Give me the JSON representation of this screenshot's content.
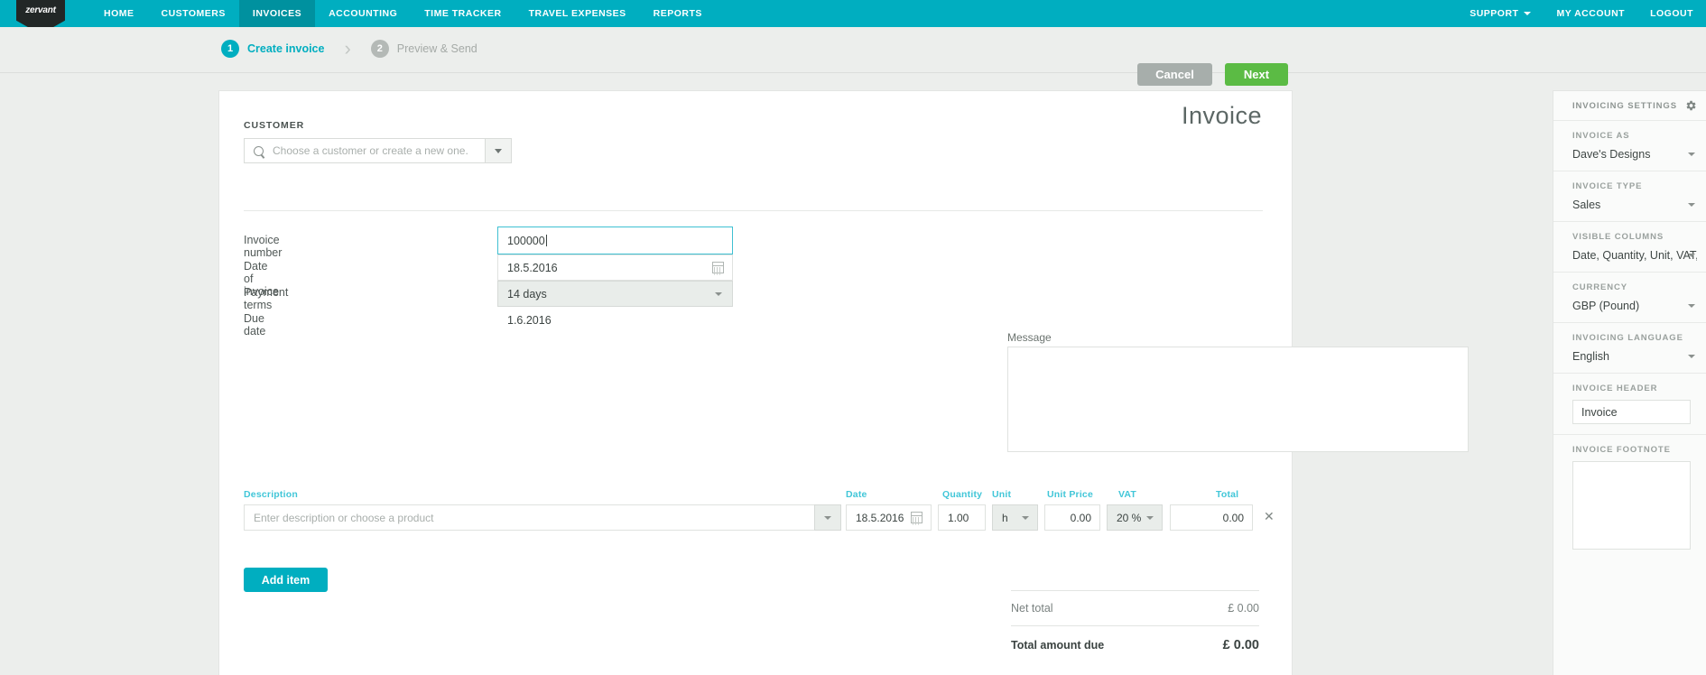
{
  "brand": {
    "logo_text": "zervant",
    "accent": "#00aec0",
    "nav_active_bg": "#00919f",
    "green": "#5bbb44",
    "gray_btn": "#a7aeab"
  },
  "topnav": {
    "items": [
      {
        "label": "HOME",
        "active": false
      },
      {
        "label": "CUSTOMERS",
        "active": false
      },
      {
        "label": "INVOICES",
        "active": true
      },
      {
        "label": "ACCOUNTING",
        "active": false
      },
      {
        "label": "TIME TRACKER",
        "active": false
      },
      {
        "label": "TRAVEL EXPENSES",
        "active": false
      },
      {
        "label": "REPORTS",
        "active": false
      }
    ],
    "right_items": [
      {
        "label": "SUPPORT",
        "caret": true
      },
      {
        "label": "MY ACCOUNT",
        "caret": false
      },
      {
        "label": "LOGOUT",
        "caret": false
      }
    ]
  },
  "stepbar": {
    "step1_num": "1",
    "step1_label": "Create invoice",
    "separator": "›",
    "step2_num": "2",
    "step2_label": "Preview & Send",
    "cancel_label": "Cancel",
    "next_label": "Next"
  },
  "invoice": {
    "title": "Invoice",
    "customer_label": "CUSTOMER",
    "customer_placeholder": "Choose a customer or create a new one.",
    "customer_value": "",
    "fields": [
      {
        "label": "Invoice number",
        "value": "100000"
      },
      {
        "label": "Date of invoice",
        "value": "18.5.2016"
      },
      {
        "label": "Payment terms",
        "value": "14 days"
      },
      {
        "label": "Due date",
        "value": "1.6.2016"
      }
    ],
    "message_label": "Message",
    "message_value": ""
  },
  "line_items": {
    "headers": {
      "description": "Description",
      "date": "Date",
      "quantity": "Quantity",
      "unit": "Unit",
      "unit_price": "Unit Price",
      "vat": "VAT",
      "total": "Total"
    },
    "rows": [
      {
        "description_placeholder": "Enter description or choose a product",
        "description": "",
        "date": "18.5.2016",
        "quantity": "1.00",
        "unit": "h",
        "unit_price": "0.00",
        "vat": "20 %",
        "total": "0.00",
        "delete_glyph": "✕"
      }
    ],
    "add_item_label": "Add item"
  },
  "totals": {
    "net_label": "Net total",
    "net_value": "£ 0.00",
    "grand_label": "Total amount due",
    "grand_value": "£ 0.00"
  },
  "sidebar": {
    "title": "INVOICING SETTINGS",
    "sections": [
      {
        "label": "INVOICE AS",
        "value": "Dave's Designs",
        "type": "select"
      },
      {
        "label": "INVOICE TYPE",
        "value": "Sales",
        "type": "select"
      },
      {
        "label": "VISIBLE COLUMNS",
        "value": "Date, Quantity, Unit, VAT, U…",
        "type": "select"
      },
      {
        "label": "CURRENCY",
        "value": "GBP (Pound)",
        "type": "select"
      },
      {
        "label": "INVOICING LANGUAGE",
        "value": "English",
        "type": "select"
      },
      {
        "label": "INVOICE HEADER",
        "value": "Invoice",
        "type": "input"
      },
      {
        "label": "INVOICE FOOTNOTE",
        "value": "",
        "type": "textarea"
      }
    ]
  }
}
